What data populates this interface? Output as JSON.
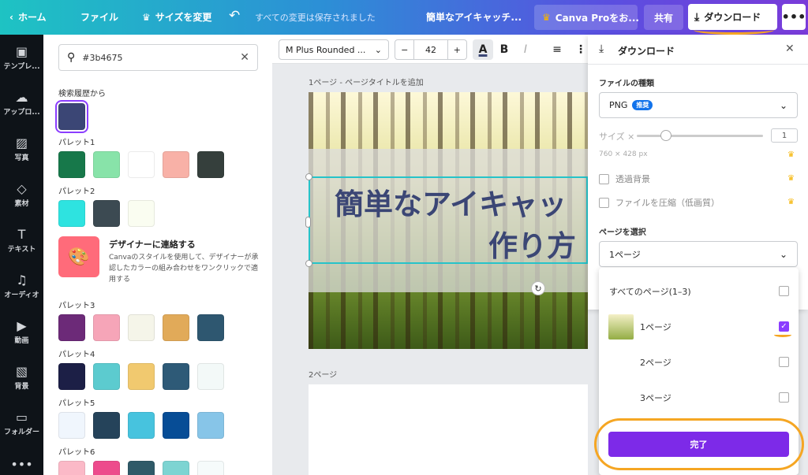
{
  "topbar": {
    "home": "ホーム",
    "file": "ファイル",
    "resize": "サイズを変更",
    "saved": "すべての変更は保存されました",
    "title": "簡単なアイキャッチ...",
    "pro": "Canva Proをお...",
    "share": "共有",
    "download": "ダウンロード",
    "more": "•••"
  },
  "leftnav": [
    {
      "icon": "template-icon",
      "glyph": "▣",
      "label": "テンプレ..."
    },
    {
      "icon": "upload-icon",
      "glyph": "☁",
      "label": "アップロ..."
    },
    {
      "icon": "photo-icon",
      "glyph": "▨",
      "label": "写真"
    },
    {
      "icon": "elements-icon",
      "glyph": "◇",
      "label": "素材"
    },
    {
      "icon": "text-icon",
      "glyph": "T",
      "label": "テキスト"
    },
    {
      "icon": "audio-icon",
      "glyph": "♫",
      "label": "オーディオ"
    },
    {
      "icon": "video-icon",
      "glyph": "▶",
      "label": "動画"
    },
    {
      "icon": "background-icon",
      "glyph": "▧",
      "label": "背景"
    },
    {
      "icon": "folder-icon",
      "glyph": "▭",
      "label": "フォルダー"
    },
    {
      "icon": "more-icon",
      "glyph": "•••",
      "label": ""
    }
  ],
  "sidepanel": {
    "search_value": "#3b4675",
    "history_label": "検索履歴から",
    "history_colors": [
      "#3b4675"
    ],
    "palettes": [
      {
        "label": "パレット1",
        "colors": [
          "#17784a",
          "#88e3a9",
          "#ffffff",
          "#f8b1a7",
          "#353f3c"
        ]
      },
      {
        "label": "パレット2",
        "colors": [
          "#2ee3e0",
          "#3c4a52",
          "#fafdf1"
        ]
      },
      {
        "label": "パレット3",
        "colors": [
          "#6c2a78",
          "#f6a5b8",
          "#f5f5e9",
          "#e1aa59",
          "#2e5770"
        ]
      },
      {
        "label": "パレット4",
        "colors": [
          "#1c1f46",
          "#5ccbcf",
          "#f1c96f",
          "#2e5a77",
          "#f3f9f8"
        ]
      },
      {
        "label": "パレット5",
        "colors": [
          "#f0f6fd",
          "#25435a",
          "#47c3de",
          "#074d96",
          "#87c5e8"
        ]
      },
      {
        "label": "パレット6",
        "colors": [
          "#fbb9c7",
          "#ed4b8c",
          "#2f5a68",
          "#7dd4d2",
          "#f6fbfb"
        ]
      }
    ],
    "designer_title": "デザイナーに連絡する",
    "designer_desc": "Canvaのスタイルを使用して、デザイナーが承認したカラーの組み合わせをワンクリックで適用する"
  },
  "toolbar": {
    "font": "M Plus Rounded ...",
    "minus": "−",
    "size": "42",
    "plus": "+",
    "color_letter": "A",
    "bold": "B",
    "italic": "I",
    "align": "≡",
    "more": "⋮"
  },
  "canvas": {
    "page1_label": "1ページ - ページタイトルを追加",
    "title_line1": "簡単なアイキャッ",
    "title_line2": "作り方",
    "page2_label": "2ページ"
  },
  "download_panel": {
    "title": "ダウンロード",
    "filetype_label": "ファイルの種類",
    "filetype": "PNG",
    "recommended_badge": "推奨",
    "size_label": "サイズ ×",
    "size_value": "1",
    "dimensions": "760 × 428 px",
    "transparent_bg": "透過背景",
    "compress": "ファイルを圧縮（低画質）",
    "select_page_label": "ページを選択",
    "selected_page": "1ページ"
  },
  "pages_dropdown": {
    "items": [
      {
        "label": "すべてのページ(1–3)",
        "checked": false
      },
      {
        "label": "1ページ",
        "checked": true
      },
      {
        "label": "2ページ",
        "checked": false
      },
      {
        "label": "3ページ",
        "checked": false
      }
    ],
    "done": "完了"
  },
  "colors": {
    "accent": "#8b3dff",
    "done_button": "#7d2ae8",
    "title_text": "#3b4675",
    "selection": "#26c3c9",
    "annotation": "#f5a623"
  }
}
